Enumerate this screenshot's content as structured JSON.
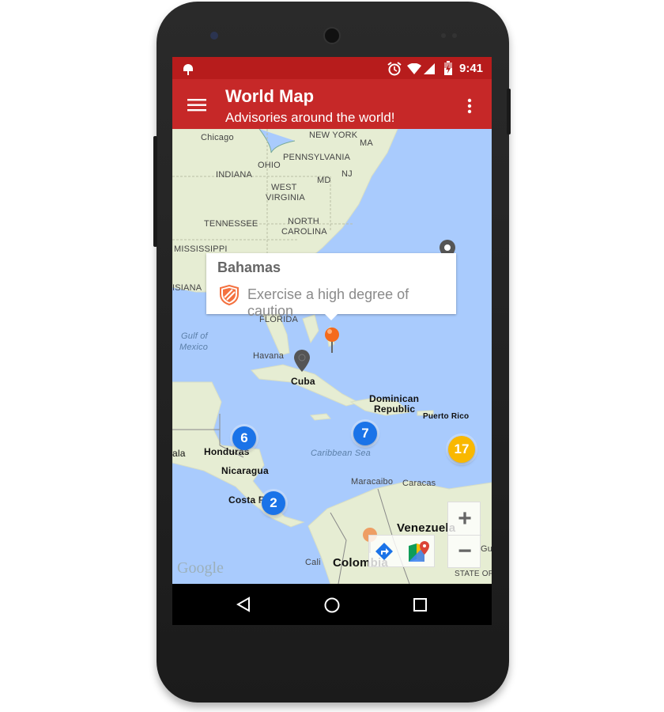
{
  "status_bar": {
    "time": "9:41",
    "icons": [
      "android-icon",
      "alarm-icon",
      "wifi-icon",
      "signal-icon",
      "battery-charging-icon"
    ]
  },
  "toolbar": {
    "title": "World Map",
    "subtitle": "Advisories around the world!",
    "menu_icon": "hamburger-icon",
    "overflow_icon": "more-vert-icon",
    "color": "#c62828"
  },
  "map": {
    "labels": {
      "chicago": "Chicago",
      "new_york": "NEW YORK",
      "ma": "MA",
      "pennsylvania": "PENNSYLVANIA",
      "ohio": "OHIO",
      "indiana": "INDIANA",
      "nj": "NJ",
      "md": "MD",
      "west": "WEST",
      "virginia": "VIRGINIA",
      "tennessee": "TENNESSEE",
      "north": "NORTH",
      "carolina": "CAROLINA",
      "mississippi": "MISSISSIPPI",
      "louisiana": "ISIANA",
      "florida": "FLORIDA",
      "gulf1": "Gulf of",
      "gulf2": "Mexico",
      "havana": "Havana",
      "cuba": "Cuba",
      "dominican": "Dominican",
      "republic": "Republic",
      "puerto_rico": "Puerto Rico",
      "guatemala": "ala",
      "honduras": "Honduras",
      "caribbean": "Caribbean Sea",
      "nicaragua": "Nicaragua",
      "maracaibo": "Maracaibo",
      "caracas": "Caracas",
      "costa_rica": "Costa Ri",
      "venezuela": "Venezuela",
      "cali": "Cali",
      "colombia": "Colombia",
      "guyana": "Gu",
      "state": "STATE OF"
    },
    "clusters": [
      {
        "count": "6",
        "color": "#1a73e8"
      },
      {
        "count": "7",
        "color": "#1a73e8"
      },
      {
        "count": "2",
        "color": "#1a73e8"
      },
      {
        "count": "17",
        "color": "#f9b800"
      }
    ],
    "info_window": {
      "title": "Bahamas",
      "advisory": "Exercise a high degree of caution",
      "icon": "shield-icon",
      "icon_color": "#f4713f"
    },
    "zoom_in": "+",
    "zoom_out": "−",
    "logo": "Google"
  },
  "nav_bar": {
    "back": "back-icon",
    "home": "home-icon",
    "recents": "recents-icon"
  }
}
